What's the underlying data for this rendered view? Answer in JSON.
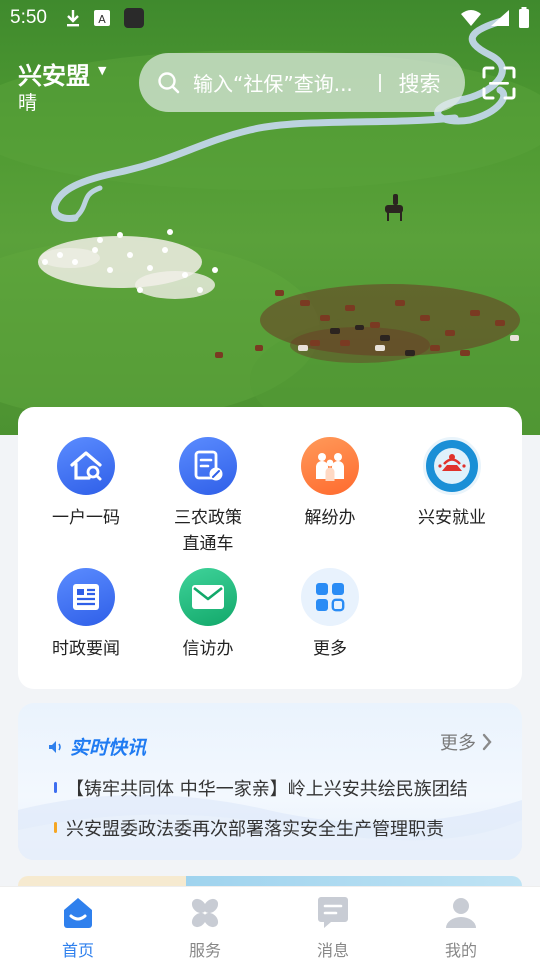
{
  "status_bar": {
    "time": "5:50",
    "icons": [
      "download-icon",
      "text-a-icon",
      "app-icon",
      "wifi-icon",
      "signal-icon",
      "battery-icon"
    ]
  },
  "header": {
    "city": "兴安盟",
    "weather": "晴",
    "search_placeholder": "输入“社保”查询...",
    "search_button": "搜索",
    "scan_icon": "scan-icon"
  },
  "services": [
    {
      "label": "一户一码",
      "icon": "house-search-icon",
      "color": "#3d6ef0"
    },
    {
      "label": "三农政策\n直通车",
      "icon": "policy-doc-icon",
      "color": "#3d6ef0"
    },
    {
      "label": "解纷办",
      "icon": "people-icon",
      "color": "#ff7a3d"
    },
    {
      "label": "兴安就业",
      "icon": "employment-emblem-icon",
      "color": "#1a8fd6"
    },
    {
      "label": "时政要闻",
      "icon": "newspaper-icon",
      "color": "#3d6ef0"
    },
    {
      "label": "信访办",
      "icon": "envelope-icon",
      "color": "#1fb37a"
    },
    {
      "label": "更多",
      "icon": "grid-more-icon",
      "color": "#2a8cf5"
    }
  ],
  "news": {
    "title": "实时快讯",
    "more": "更多",
    "items": [
      {
        "text": "【铸牢共同体 中华一家亲】岭上兴安共绘民族团结",
        "dot_color": "#3d6ef0"
      },
      {
        "text": "兴安盟委政法委再次部署落实安全生产管理职责",
        "dot_color": "#f5a623"
      }
    ]
  },
  "tabbar": {
    "tabs": [
      {
        "label": "首页",
        "icon": "home-icon",
        "active": true
      },
      {
        "label": "服务",
        "icon": "services-icon",
        "active": false
      },
      {
        "label": "消息",
        "icon": "message-icon",
        "active": false
      },
      {
        "label": "我的",
        "icon": "profile-icon",
        "active": false
      }
    ],
    "active_color": "#2f80ed",
    "inactive_color": "#c8ccd4"
  }
}
